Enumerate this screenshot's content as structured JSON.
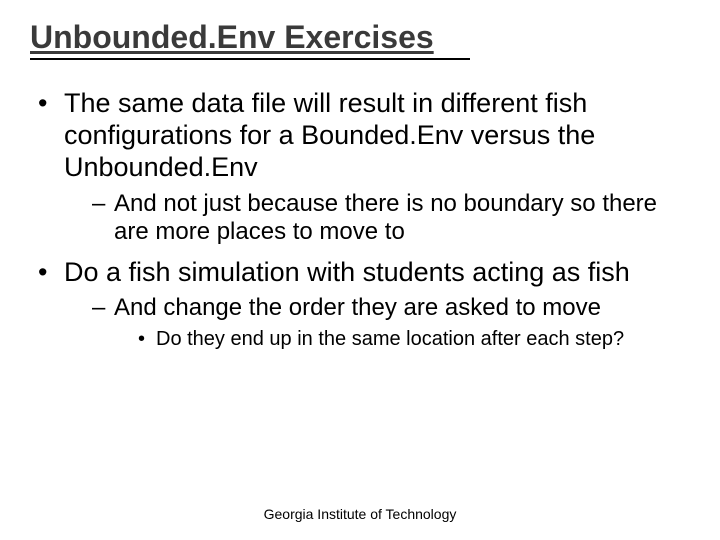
{
  "title": "Unbounded.Env Exercises",
  "bullets": {
    "a": "The same data file will result in different fish configurations for a Bounded.Env versus the Unbounded.Env",
    "a1": "And not just because there is no boundary so there are more places to move to",
    "b": "Do a fish simulation with students acting as fish",
    "b1": "And change the order they are asked to move",
    "b1a": "Do they end up in the same location after each step?"
  },
  "footer": "Georgia Institute of Technology"
}
